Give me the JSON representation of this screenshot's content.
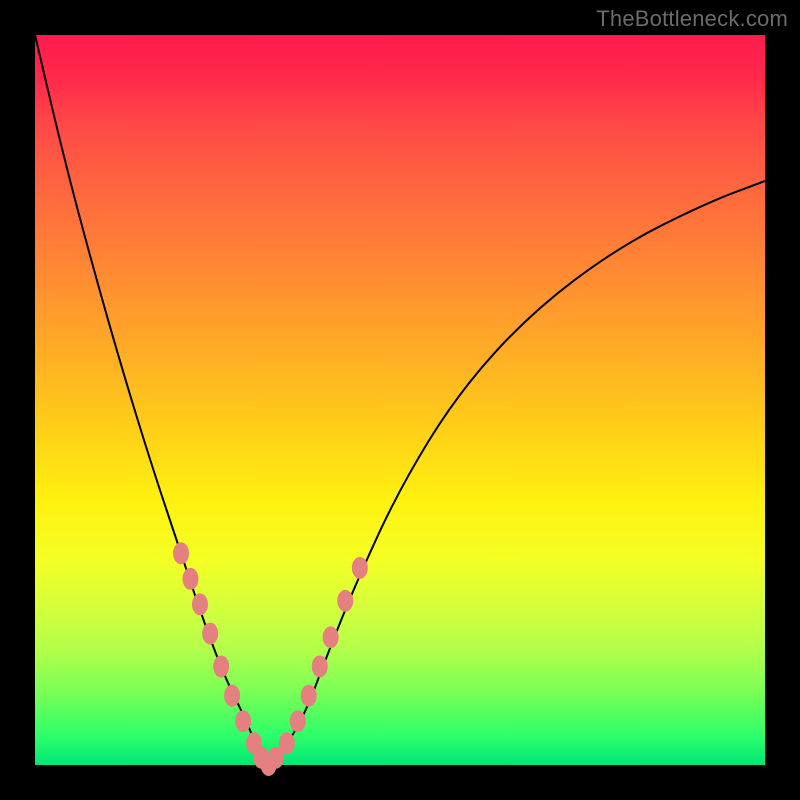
{
  "watermark": "TheBottleneck.com",
  "colors": {
    "marker": "#e58080",
    "curve": "#000000",
    "frame_bg": "#000000"
  },
  "chart_data": {
    "type": "line",
    "title": "",
    "xlabel": "",
    "ylabel": "",
    "xlim": [
      0,
      100
    ],
    "ylim": [
      0,
      100
    ],
    "note": "Axes are relative (0–100) within the plot rectangle; x is left→right, y is bottom→top. Values estimated from pixels.",
    "series": [
      {
        "name": "curve",
        "kind": "path",
        "x": [
          0,
          4,
          8,
          12,
          16,
          20,
          23,
          26,
          29,
          30.5,
          32,
          34,
          37,
          40,
          44,
          50,
          58,
          68,
          80,
          92,
          100
        ],
        "y": [
          100,
          83,
          68,
          54,
          41,
          29,
          20,
          12,
          6,
          2,
          0,
          2,
          7,
          15,
          25,
          38,
          51,
          62,
          71,
          77,
          80
        ]
      },
      {
        "name": "markers",
        "kind": "scatter",
        "x": [
          20.0,
          21.3,
          22.6,
          24.0,
          25.5,
          27.0,
          28.5,
          30.0,
          31.0,
          32.0,
          33.0,
          34.5,
          36.0,
          37.5,
          39.0,
          40.5,
          42.5,
          44.5
        ],
        "y": [
          29.0,
          25.5,
          22.0,
          18.0,
          13.5,
          9.5,
          6.0,
          3.0,
          1.0,
          0.0,
          1.0,
          3.0,
          6.0,
          9.5,
          13.5,
          17.5,
          22.5,
          27.0
        ]
      }
    ]
  }
}
